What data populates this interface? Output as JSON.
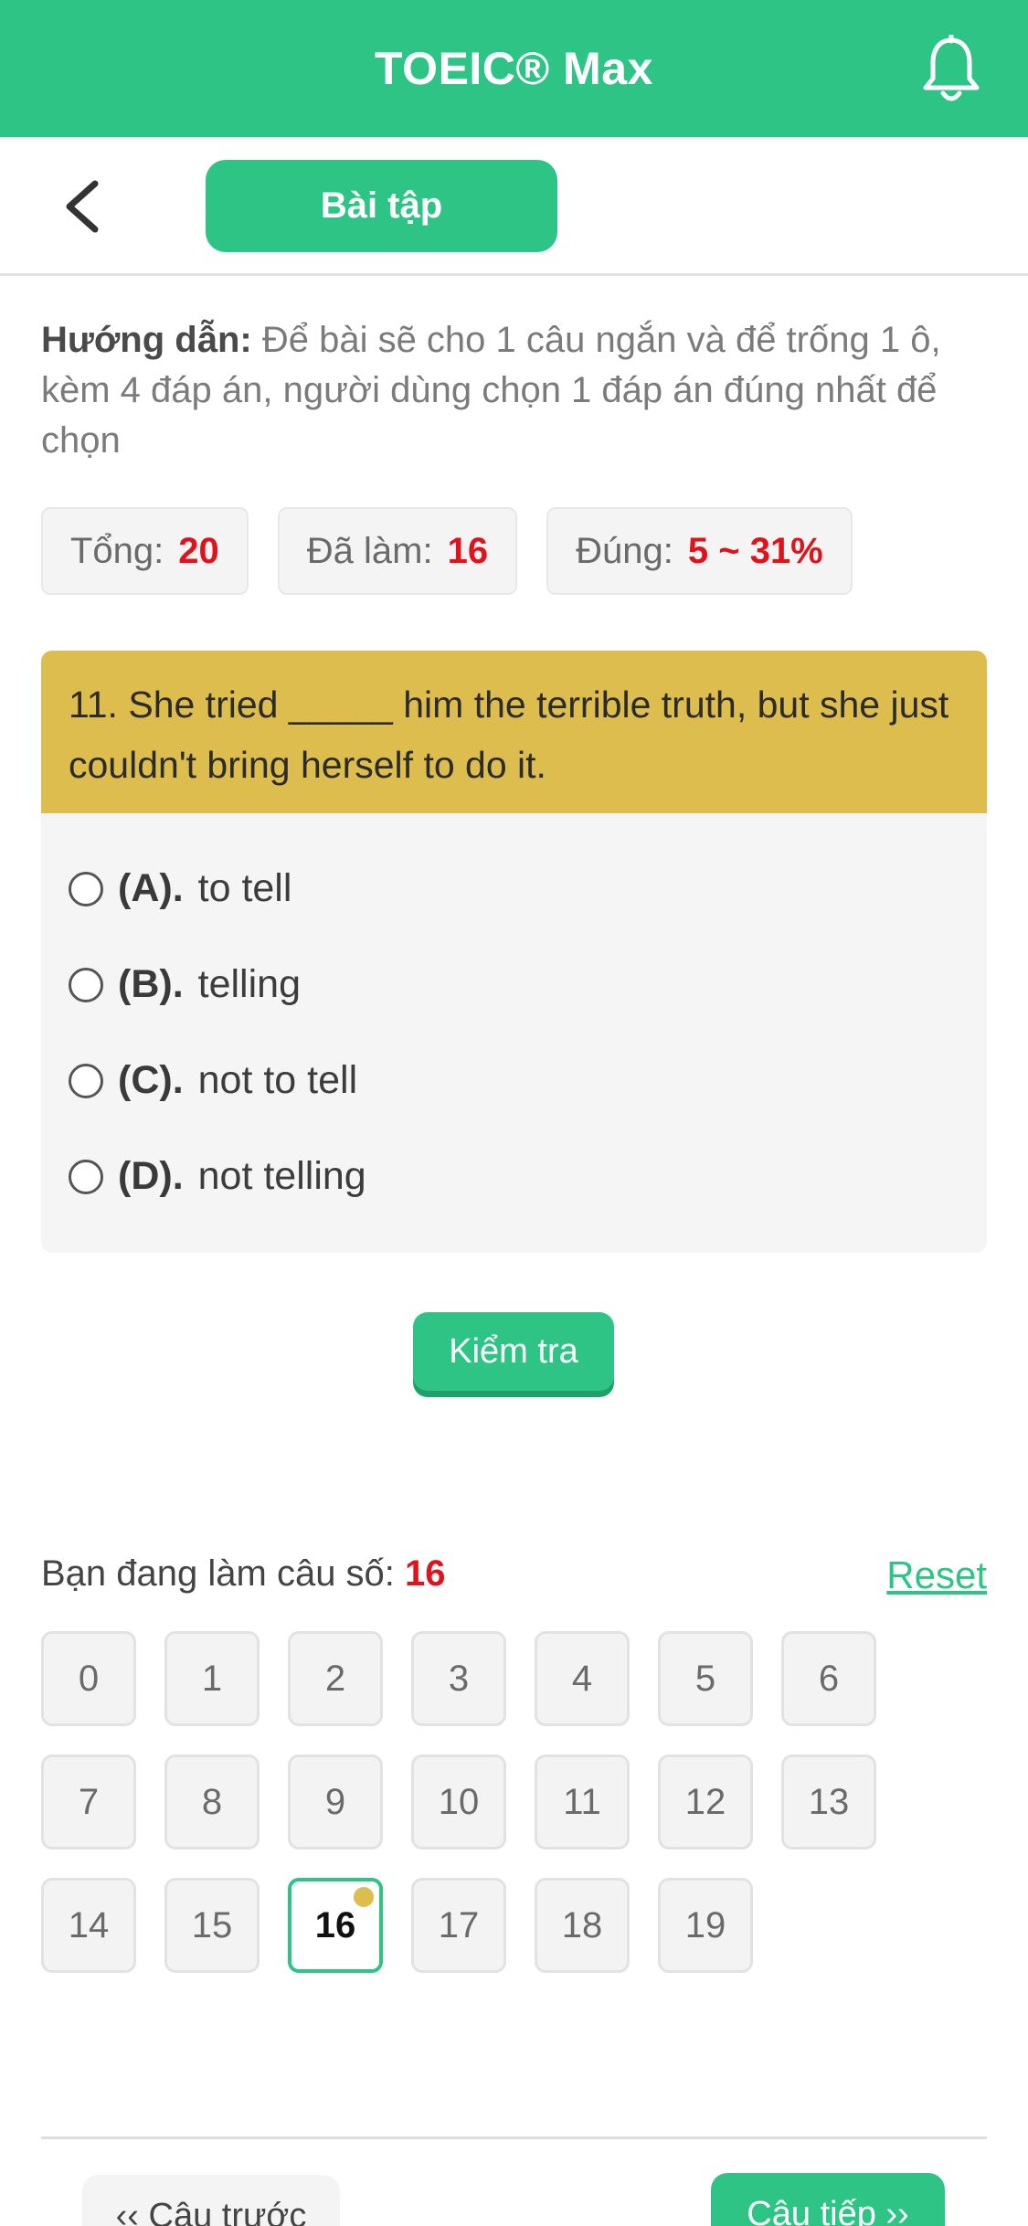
{
  "header": {
    "title": "TOEIC® Max",
    "bell_icon": "bell-icon"
  },
  "subbar": {
    "back_icon": "chevron-left-icon",
    "tab_label": "Bài tập"
  },
  "guide": {
    "label": "Hướng dẫn:",
    "text": "Để bài sẽ cho 1 câu ngắn và để trống 1 ô, kèm 4 đáp án, người dùng chọn 1 đáp án đúng nhất để chọn"
  },
  "stats": {
    "total_label": "Tổng:",
    "total_value": "20",
    "done_label": "Đã làm:",
    "done_value": "16",
    "correct_label": "Đúng:",
    "correct_value": "5 ~ 31%"
  },
  "question": {
    "text": "11. She tried _____ him the terrible truth, but she just couldn't bring herself to do it.",
    "options": [
      {
        "key": "(A).",
        "text": "to tell"
      },
      {
        "key": "(B).",
        "text": "telling"
      },
      {
        "key": "(C).",
        "text": "not to tell"
      },
      {
        "key": "(D).",
        "text": "not telling"
      }
    ]
  },
  "check_button": "Kiểm tra",
  "progress": {
    "label": "Bạn đang làm câu số:",
    "current": "16",
    "reset": "Reset"
  },
  "grid": [
    "0",
    "1",
    "2",
    "3",
    "4",
    "5",
    "6",
    "7",
    "8",
    "9",
    "10",
    "11",
    "12",
    "13",
    "14",
    "15",
    "16",
    "17",
    "18",
    "19"
  ],
  "active_index": 16,
  "nav": {
    "prev": "‹‹ Câu trước",
    "next": "Câu tiếp ››"
  },
  "colors": {
    "brand": "#2ec486",
    "question_bg": "#dcbd4e",
    "highlight": "#e0121b"
  }
}
